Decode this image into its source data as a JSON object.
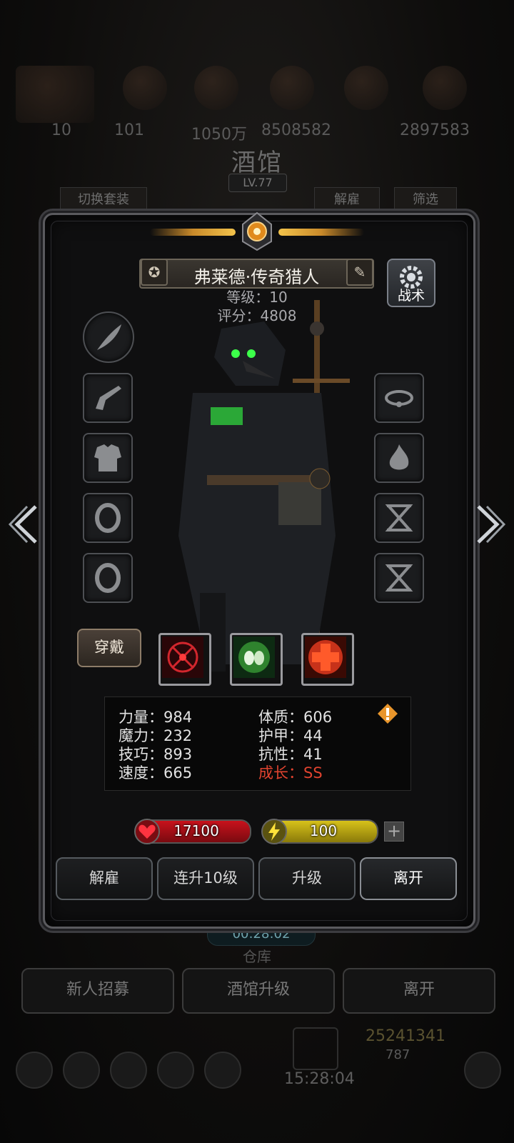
{
  "background": {
    "resource_values": [
      "10",
      "101",
      "1050万",
      "8508582",
      "2897583"
    ],
    "title": "酒馆",
    "level": "LV.77",
    "tab_switch_outfit": "切换套装",
    "tab_dismiss": "解雇",
    "tab_filter": "筛选",
    "timer": "00:28:02",
    "warehouse": "仓库",
    "btn_recruit": "新人招募",
    "btn_upgrade_tavern": "酒馆升级",
    "btn_leave": "离开",
    "gold": "25241341",
    "gems": "787",
    "clock": "15:28:04"
  },
  "hero": {
    "name": "弗莱德·传奇猎人",
    "level_label": "等级：10",
    "score_label": "评分：4808",
    "tactic_label": "战术",
    "equip_label": "穿戴"
  },
  "stats": {
    "strength": "力量：984",
    "magic": "魔力：232",
    "skill": "技巧：893",
    "speed": "速度：665",
    "constitution": "体质：606",
    "armor": "护甲：44",
    "resistance": "抗性：41",
    "growth": "成长：SS"
  },
  "bars": {
    "hp": "17100",
    "energy": "100",
    "hp_color": "#c8121c",
    "energy_color": "#d7c21a"
  },
  "actions": {
    "dismiss": "解雇",
    "level10": "连升10级",
    "upgrade": "升级",
    "leave": "离开"
  }
}
